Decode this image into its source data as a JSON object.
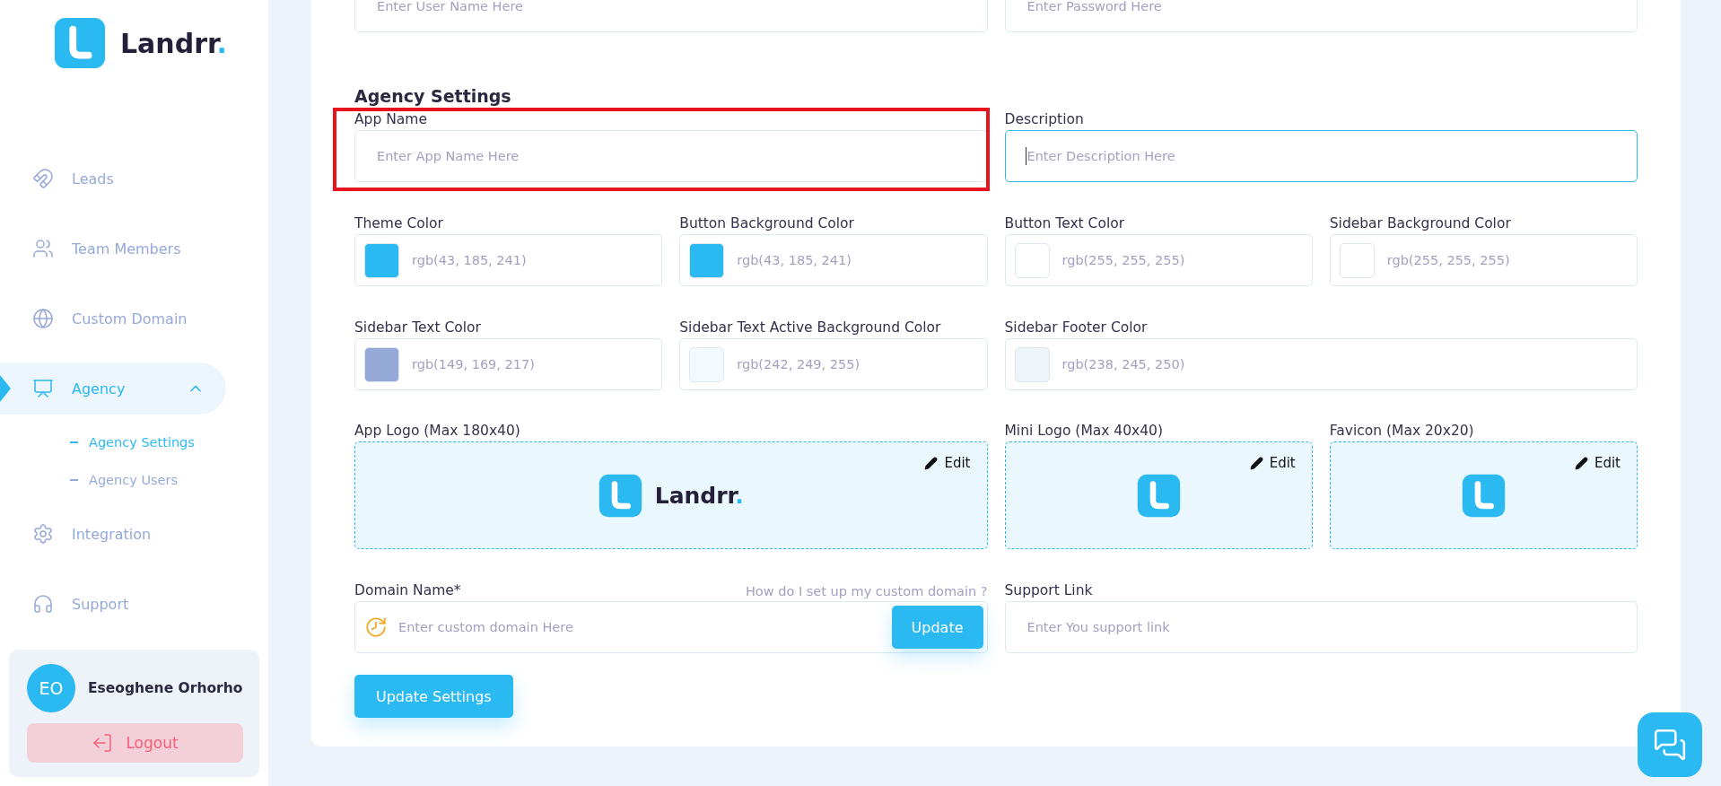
{
  "sidebar": {
    "brand": {
      "name": "Landrr",
      "dot": "."
    },
    "nav": [
      {
        "label": "Leads",
        "selected": false
      },
      {
        "label": "Team Members",
        "selected": false
      },
      {
        "label": "Custom Domain",
        "selected": false
      },
      {
        "label": "Agency",
        "selected": true,
        "expanded": true,
        "children": [
          {
            "label": "Agency Settings",
            "selected": true
          },
          {
            "label": "Agency Users",
            "selected": false
          }
        ]
      },
      {
        "label": "Integration",
        "selected": false
      },
      {
        "label": "Support",
        "selected": false
      }
    ],
    "user": {
      "initials": "EO",
      "name": "Eseoghene Orhorho"
    },
    "logout": "Logout"
  },
  "form": {
    "top_fields": [
      {
        "placeholder": "Enter User Name Here"
      },
      {
        "placeholder": "Enter Password Here"
      }
    ],
    "section_title": "Agency Settings",
    "text_fields": [
      {
        "label": "App Name",
        "placeholder": "Enter App Name Here",
        "highlighted": true,
        "focused": false
      },
      {
        "label": "Description",
        "placeholder": "Enter Description Here",
        "highlighted": false,
        "focused": true
      }
    ],
    "colors": [
      {
        "label": "Theme Color",
        "value": "rgb(43, 185, 241)",
        "color": "#2bb9f1"
      },
      {
        "label": "Button Background Color",
        "value": "rgb(43, 185, 241)",
        "color": "#2bb9f1"
      },
      {
        "label": "Button Text Color",
        "value": "rgb(255, 255, 255)",
        "color": "#ffffff"
      },
      {
        "label": "Sidebar Background Color",
        "value": "rgb(255, 255, 255)",
        "color": "#ffffff"
      },
      {
        "label": "Sidebar Text Color",
        "value": "rgb(149, 169, 217)",
        "color": "#95a9d9"
      },
      {
        "label": "Sidebar Text Active Background Color",
        "value": "rgb(242, 249, 255)",
        "color": "#f2f9ff"
      },
      {
        "label": "Sidebar Footer Color",
        "value": "rgb(238, 245, 250)",
        "color": "#eef5fa"
      }
    ],
    "logos": [
      {
        "label": "App Logo (Max 180x40)",
        "edit": "Edit",
        "kind": "wide",
        "brand": {
          "name": "Landrr",
          "dot": "."
        }
      },
      {
        "label": "Mini Logo (Max 40x40)",
        "edit": "Edit",
        "kind": "mark"
      },
      {
        "label": "Favicon (Max 20x20)",
        "edit": "Edit",
        "kind": "mark"
      }
    ],
    "domain": {
      "label": "Domain Name*",
      "help_link": "How do I set up my custom domain ?",
      "placeholder": "Enter custom domain Here",
      "button": "Update"
    },
    "support": {
      "label": "Support Link",
      "placeholder": "Enter You support link"
    },
    "submit": "Update Settings"
  }
}
